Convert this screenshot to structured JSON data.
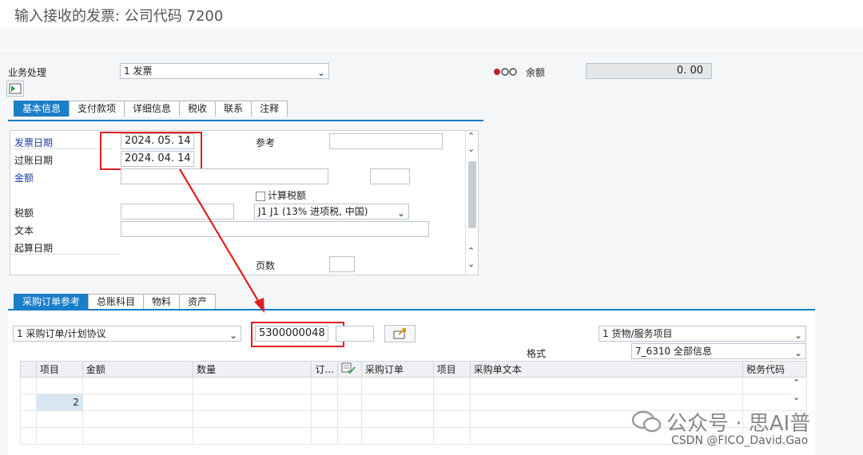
{
  "title": "输入接收的发票: 公司代码 7200",
  "header": {
    "trans_label": "业务处理",
    "trans_value": "1 发票",
    "balance_label": "余额",
    "balance_value": "0. 00"
  },
  "tabs_top": [
    "基本信息",
    "支付款项",
    "详细信息",
    "税收",
    "联系",
    "注释"
  ],
  "basic": {
    "invoice_date_label": "发票日期",
    "invoice_date": "2024. 05. 14",
    "posting_date_label": "过账日期",
    "posting_date": "2024. 04. 14",
    "amount_label": "金额",
    "reference_label": "参考",
    "calc_tax_label": "计算税额",
    "tax_amount_label": "税额",
    "tax_code": "J1 J1 (13% 进项税, 中国)",
    "text_label": "文本",
    "baseline_label": "起算日期",
    "pages_label": "页数"
  },
  "tabs_bottom": [
    "采购订单参考",
    "总账科目",
    "物料",
    "资产"
  ],
  "po": {
    "ref_type": "1 采购订单/计划协议",
    "po_number": "5300000048",
    "item_type": "1 货物/服务项目",
    "layout_label": "格式",
    "layout_value": "7_6310 全部信息"
  },
  "table": {
    "headers": [
      "项目",
      "金额",
      "数量",
      "订...",
      "",
      "采购订单",
      "项目",
      "采购单文本",
      "税务代码"
    ],
    "first_cell": "2"
  },
  "watermark": {
    "line1": "公众号 · 思AI普",
    "line2": "CSDN @FICO_David.Gao"
  },
  "colors": {
    "accent": "#1a7ec8",
    "highlight": "#e02020"
  }
}
